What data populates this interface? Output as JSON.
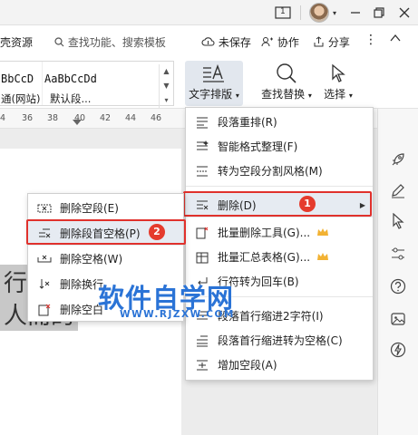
{
  "titlebar": {
    "page_indicator": "1",
    "sep": "|"
  },
  "actions": {
    "resources_partial": "壳资源",
    "search_placeholder": "查找功能、搜索模板",
    "unsaved": "未保存",
    "collab": "协作",
    "share": "分享"
  },
  "ribbon": {
    "style1_sample": "BbCcD",
    "style1_name": "通(网站)",
    "style2_sample": "AaBbCcDd",
    "style2_name": "默认段...",
    "text_layout": "文字排版",
    "find_replace": "查找替换",
    "select": "选择"
  },
  "ruler": {
    "ticks": [
      "4",
      "36",
      "38",
      "40",
      "42",
      "44",
      "46"
    ]
  },
  "document": {
    "line1": "行i",
    "line2": "人而的"
  },
  "main_menu": {
    "items": [
      "段落重排(R)",
      "智能格式整理(F)",
      "转为空段分割风格(M)",
      "删除(D)",
      "批量删除工具(G)...",
      "批量汇总表格(G)...",
      "行符转为回车(B)",
      "段落首行缩进2字符(I)",
      "段落首行缩进转为空格(C)",
      "增加空段(A)"
    ]
  },
  "sub_menu": {
    "items": [
      "删除空段(E)",
      "删除段首空格(P)",
      "删除空格(W)",
      "删除换行",
      "删除空白"
    ]
  },
  "annotations": {
    "badge1": "1",
    "badge2": "2"
  },
  "watermark": {
    "main": "软件自学网",
    "sub": "WWW.RJZXW.COM"
  },
  "colors": {
    "accent_red": "#e0312c",
    "watermark_blue": "#2a73d6",
    "crown": "#f2b233"
  },
  "icons": [
    "page-icon",
    "avatar",
    "minimize-icon",
    "restore-icon",
    "close-icon",
    "search-icon",
    "cloud-icon",
    "collab-icon",
    "share-icon",
    "more-icon",
    "collapse-icon",
    "text-layout-icon",
    "magnifier-icon",
    "cursor-icon",
    "rocket-icon",
    "pen-icon",
    "pointer-icon",
    "sliders-icon",
    "help-icon",
    "image-icon",
    "bolt-icon",
    "crown-icon"
  ]
}
